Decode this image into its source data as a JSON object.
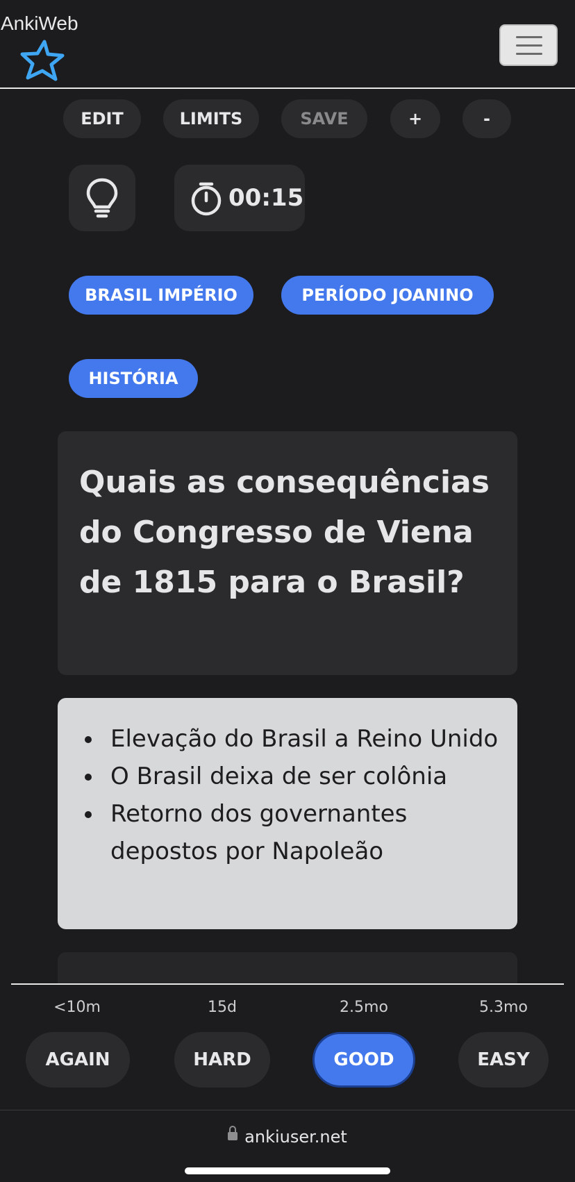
{
  "header": {
    "title": "AnkiWeb",
    "menu_icon": "hamburger-icon",
    "logo_icon": "star-icon"
  },
  "toolbar": {
    "edit": "EDIT",
    "limits": "LIMITS",
    "save": "SAVE",
    "plus": "+",
    "minus": "-"
  },
  "controls": {
    "hint_icon": "lightbulb-icon",
    "timer_icon": "stopwatch-icon",
    "timer": "00:15"
  },
  "tags": [
    "BRASIL IMPÉRIO",
    "PERÍODO JOANINO",
    "HISTÓRIA"
  ],
  "card": {
    "question": "Quais as consequências do Congresso de Viena de 1815 para o Brasil?",
    "answers": [
      "Elevação do Brasil a Reino Unido",
      "O Brasil deixa de ser colônia",
      "Retorno dos governantes depostos por Napoleão"
    ]
  },
  "answer_buttons": [
    {
      "interval": "<10m",
      "label": "AGAIN"
    },
    {
      "interval": "15d",
      "label": "HARD"
    },
    {
      "interval": "2.5mo",
      "label": "GOOD"
    },
    {
      "interval": "5.3mo",
      "label": "EASY"
    }
  ],
  "browser": {
    "url": "ankiuser.net",
    "lock_icon": "lock-icon"
  },
  "colors": {
    "accent": "#4479ee",
    "background": "#1c1c1e",
    "surface": "#2b2b2d",
    "answer_card": "#d7d8da"
  }
}
